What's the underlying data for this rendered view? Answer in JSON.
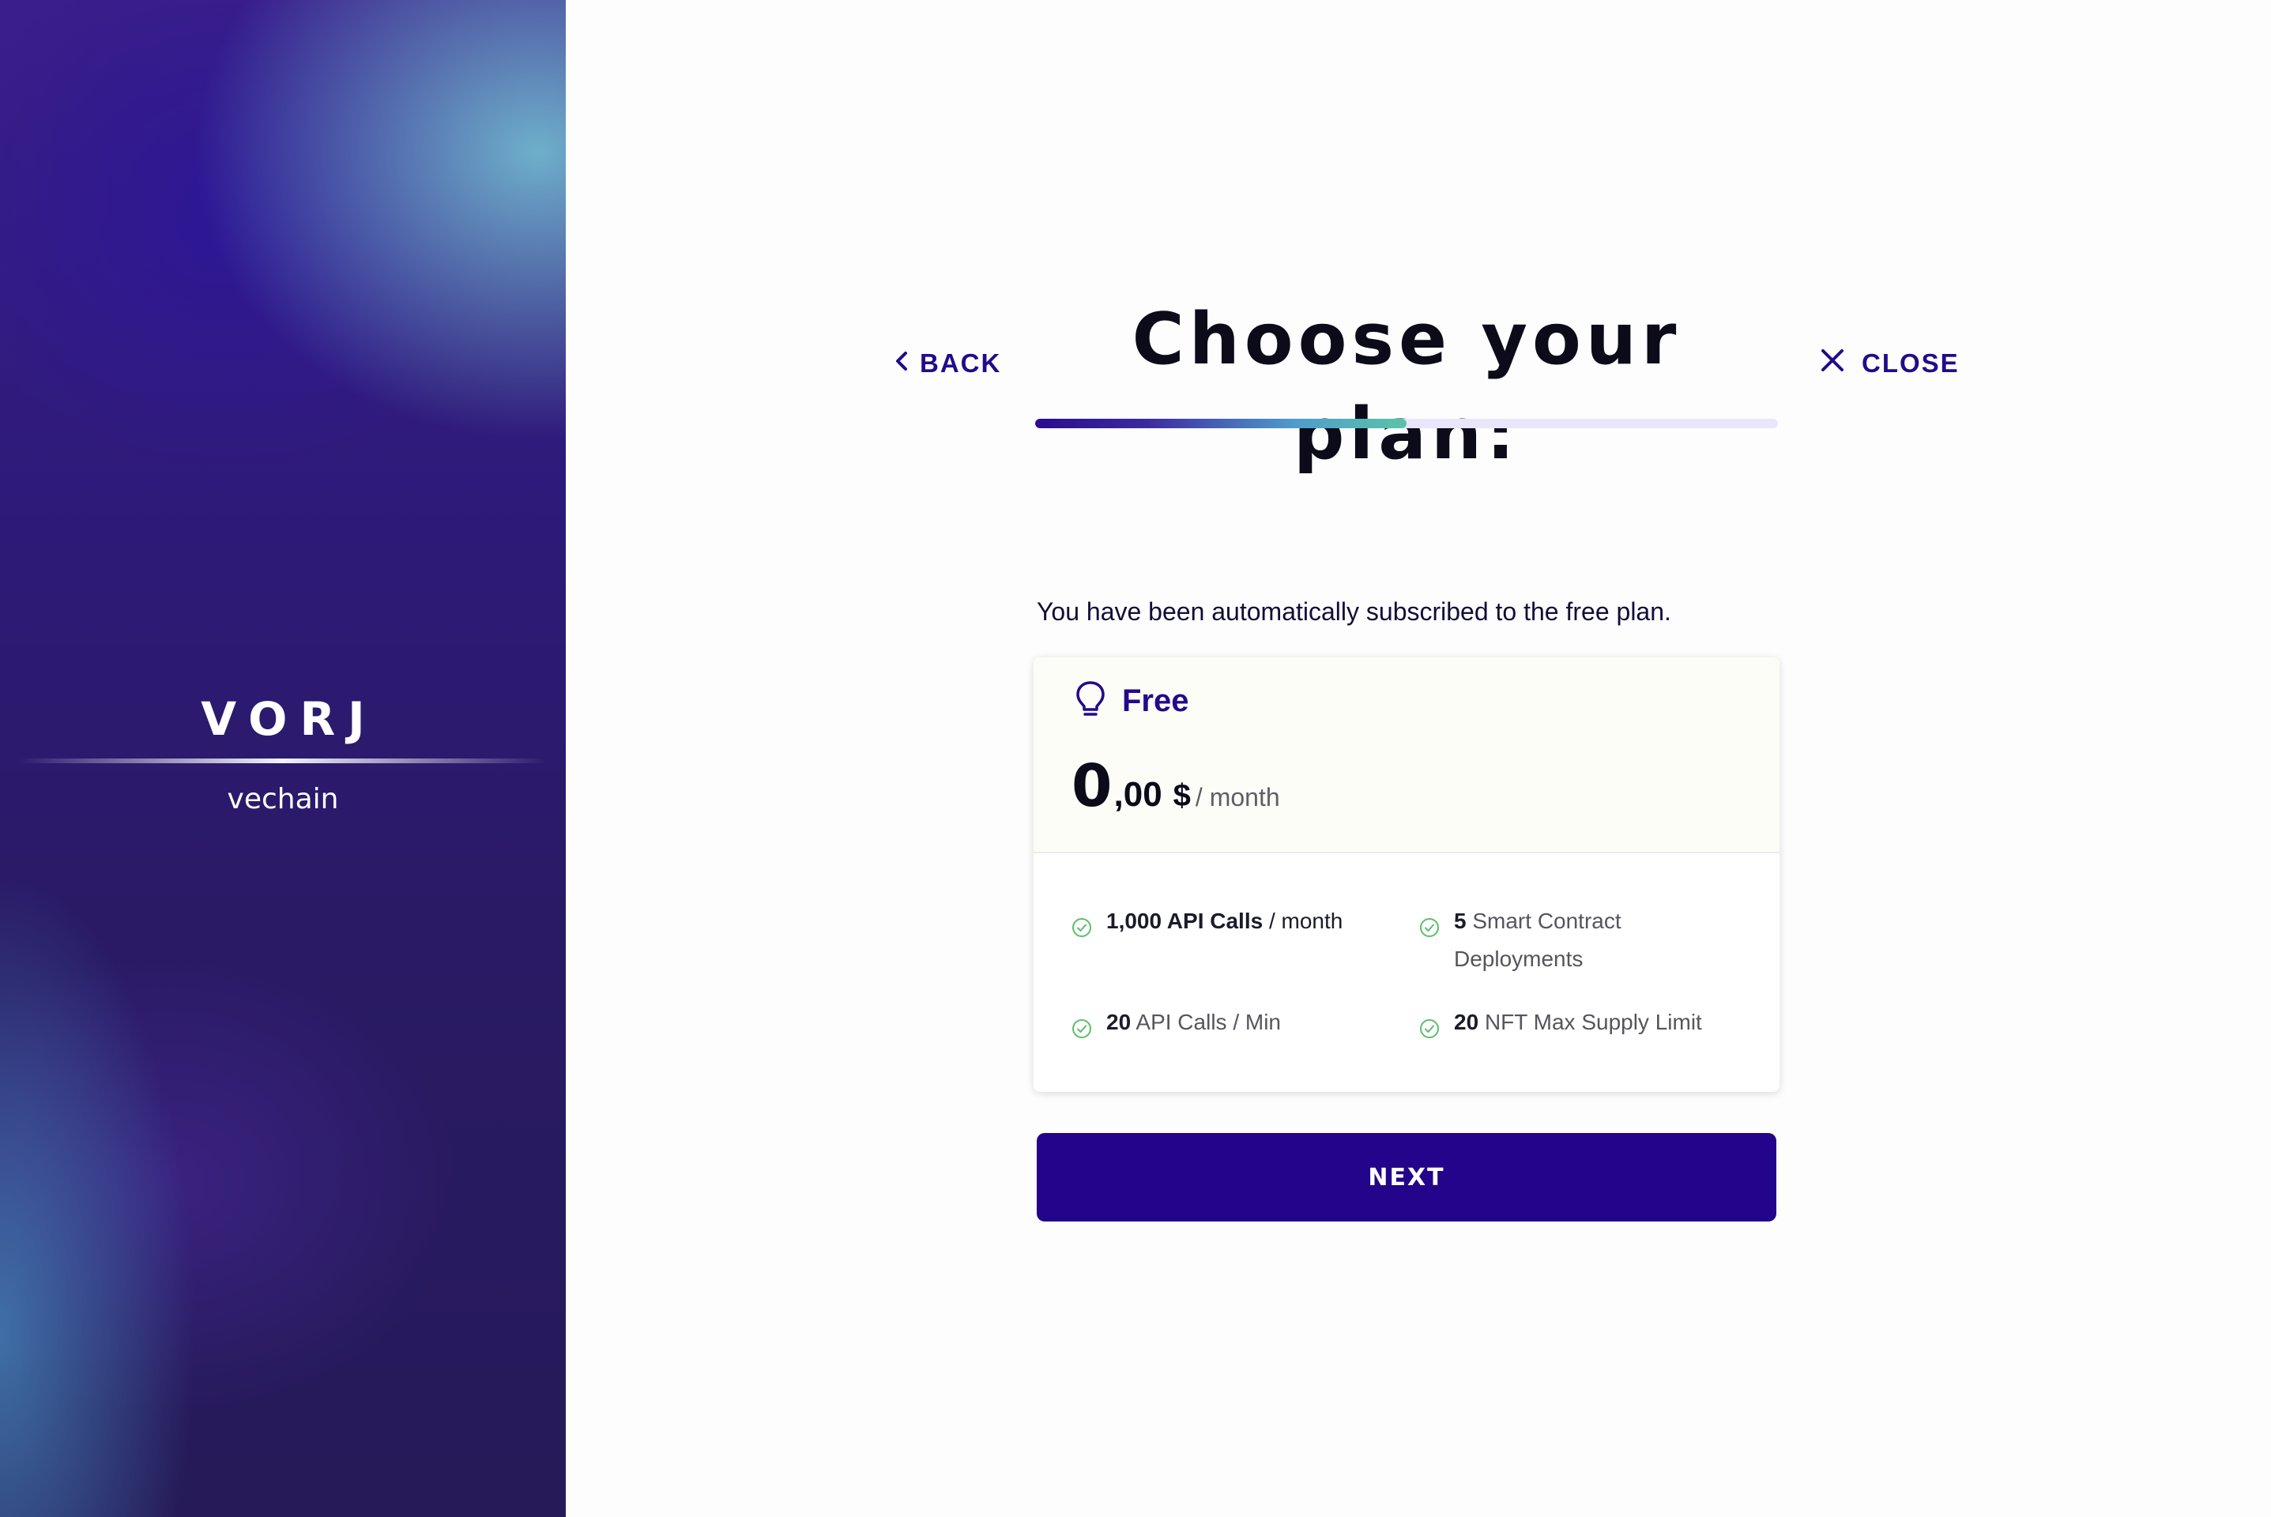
{
  "brand": {
    "logo": "VORJ",
    "partner": "vechain"
  },
  "header": {
    "back_label": "BACK",
    "title": "Choose your plan:",
    "close_label": "CLOSE",
    "progress": 0.5
  },
  "content": {
    "notice": "You have been automatically subscribed to the free plan.",
    "plan": {
      "icon": "lightbulb-icon",
      "name": "Free",
      "price_int": "0",
      "price_dec": ",00",
      "currency": "$",
      "period": "/ month",
      "features": [
        {
          "value": "1,000 API Calls",
          "text": "/ month"
        },
        {
          "value": "5",
          "text": "Smart Contract Deployments"
        },
        {
          "value": "20",
          "text": "API Calls / Min"
        },
        {
          "value": "20",
          "text": "NFT Max Supply Limit"
        }
      ]
    },
    "next_label": "NEXT"
  },
  "colors": {
    "accent": "#22058a",
    "check": "#5bbf6a",
    "card_header_bg": "#fdfdf7"
  }
}
